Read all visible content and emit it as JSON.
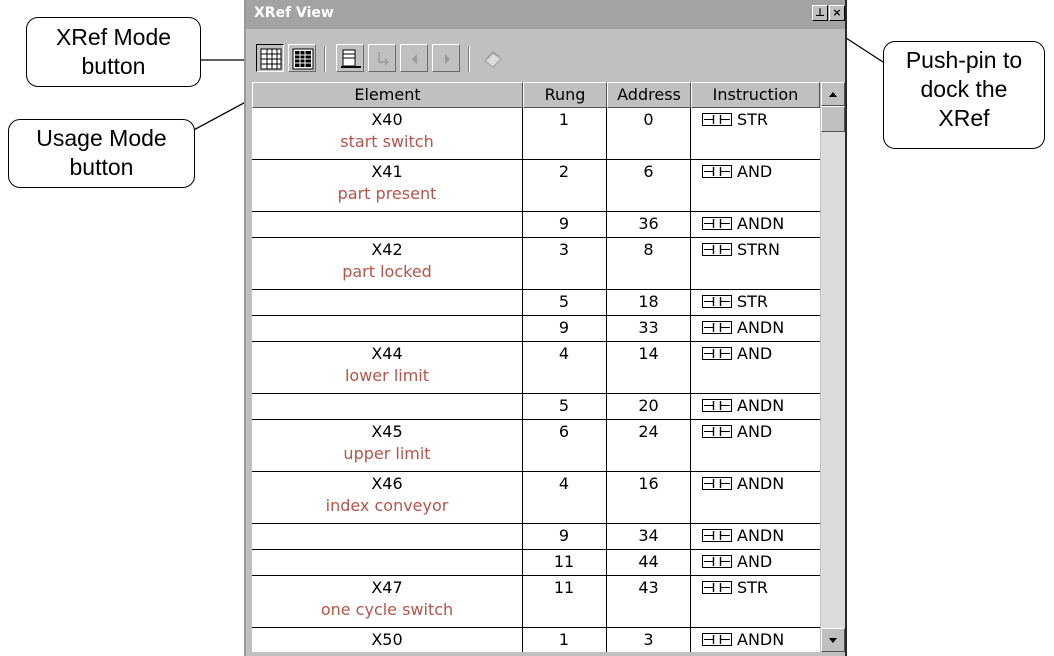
{
  "callouts": {
    "xref_mode": [
      "XRef Mode",
      "button"
    ],
    "usage_mode": [
      "Usage Mode",
      "button"
    ],
    "pushpin": [
      "Push-pin to",
      "dock the",
      "XRef"
    ]
  },
  "window": {
    "title": "XRef View",
    "pin_glyph": "⊥",
    "close_glyph": "×"
  },
  "columns": [
    "Element",
    "Rung",
    "Address",
    "Instruction"
  ],
  "rows": [
    {
      "element": "X40",
      "desc": "start switch",
      "rung": "1",
      "address": "0",
      "instruction": "STR"
    },
    {
      "element": "X41",
      "desc": "part present",
      "rung": "2",
      "address": "6",
      "instruction": "AND"
    },
    {
      "element": "",
      "desc": "",
      "rung": "9",
      "address": "36",
      "instruction": "ANDN"
    },
    {
      "element": "X42",
      "desc": "part locked",
      "rung": "3",
      "address": "8",
      "instruction": "STRN"
    },
    {
      "element": "",
      "desc": "",
      "rung": "5",
      "address": "18",
      "instruction": "STR"
    },
    {
      "element": "",
      "desc": "",
      "rung": "9",
      "address": "33",
      "instruction": "ANDN"
    },
    {
      "element": "X44",
      "desc": "lower limit",
      "rung": "4",
      "address": "14",
      "instruction": "AND"
    },
    {
      "element": "",
      "desc": "",
      "rung": "5",
      "address": "20",
      "instruction": "ANDN"
    },
    {
      "element": "X45",
      "desc": "upper limit",
      "rung": "6",
      "address": "24",
      "instruction": "AND"
    },
    {
      "element": "X46",
      "desc": "index conveyor",
      "rung": "4",
      "address": "16",
      "instruction": "ANDN"
    },
    {
      "element": "",
      "desc": "",
      "rung": "9",
      "address": "34",
      "instruction": "ANDN"
    },
    {
      "element": "",
      "desc": "",
      "rung": "11",
      "address": "44",
      "instruction": "AND"
    },
    {
      "element": "X47",
      "desc": "one cycle switch",
      "rung": "11",
      "address": "43",
      "instruction": "STR"
    },
    {
      "element": "X50",
      "desc": "",
      "rung": "1",
      "address": "3",
      "instruction": "ANDN"
    }
  ],
  "colors": {
    "description_text": "#b5544a",
    "title_bar": "#a3a3a3",
    "window_face": "#c0c0c0"
  },
  "icons": {
    "toolbar": [
      "xref-mode-icon",
      "usage-mode-icon",
      "find-icon",
      "goto-icon",
      "prev-icon",
      "next-icon",
      "print-icon"
    ],
    "instruction": "contact-icon"
  }
}
